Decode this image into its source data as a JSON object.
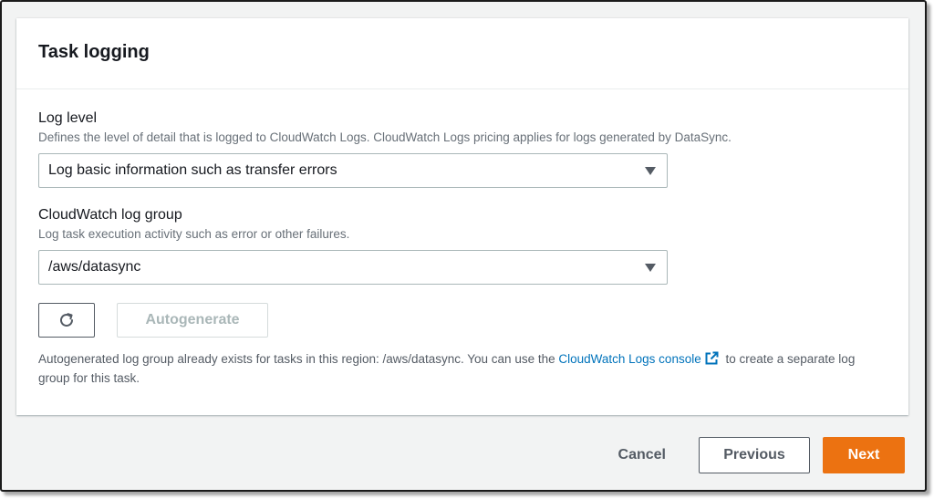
{
  "panel": {
    "title": "Task logging"
  },
  "log_level": {
    "label": "Log level",
    "description": "Defines the level of detail that is logged to CloudWatch Logs. CloudWatch Logs pricing applies for logs generated by DataSync.",
    "selected": "Log basic information such as transfer errors"
  },
  "log_group": {
    "label": "CloudWatch log group",
    "description": "Log task execution activity such as error or other failures.",
    "selected": "/aws/datasync",
    "autogenerate_label": "Autogenerate",
    "help_prefix": "Autogenerated log group already exists for tasks in this region: /aws/datasync. You can use the",
    "help_link": "CloudWatch Logs console",
    "help_suffix": "to create a separate log group for this task."
  },
  "footer": {
    "cancel_label": "Cancel",
    "previous_label": "Previous",
    "next_label": "Next"
  },
  "colors": {
    "primary_button": "#ec7211",
    "link": "#0073bb",
    "panel_background": "#ffffff",
    "page_background": "#f2f3f3"
  },
  "icons": {
    "refresh": "refresh-icon",
    "external_link": "external-link-icon",
    "dropdown": "caret-down-icon"
  }
}
